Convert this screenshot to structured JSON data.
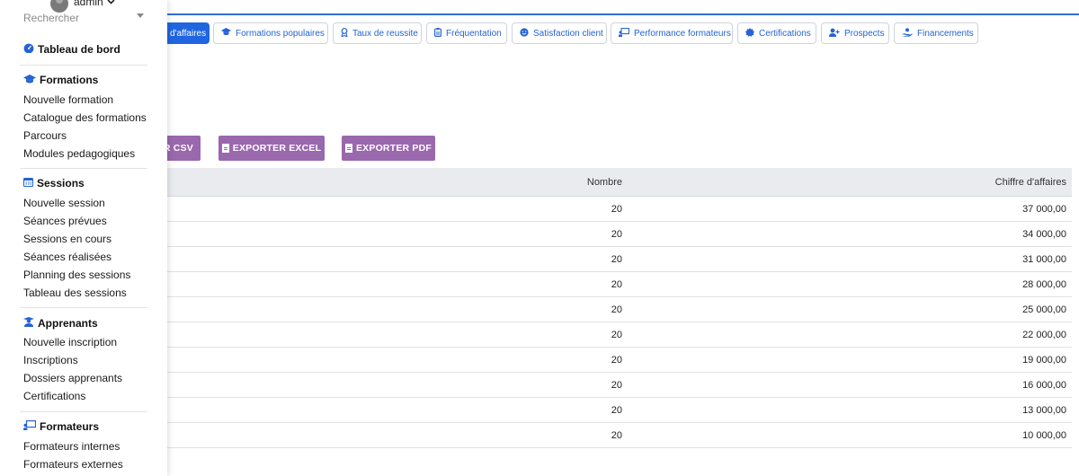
{
  "sidebar": {
    "user": {
      "name": "admin"
    },
    "search": {
      "placeholder": "Rechercher"
    },
    "dashboard": {
      "label": "Tableau de bord"
    },
    "sections": {
      "formations": {
        "title": "Formations",
        "items": [
          "Nouvelle formation",
          "Catalogue des formations",
          "Parcours",
          "Modules pedagogiques"
        ]
      },
      "sessions": {
        "title": "Sessions",
        "items": [
          "Nouvelle session",
          "Séances prévues",
          "Sessions en cours",
          "Séances réalisées",
          "Planning des sessions",
          "Tableau des sessions"
        ]
      },
      "apprenants": {
        "title": "Apprenants",
        "items": [
          "Nouvelle inscription",
          "Inscriptions",
          "Dossiers apprenants",
          "Certifications"
        ]
      },
      "formateurs": {
        "title": "Formateurs",
        "items": [
          "Formateurs internes",
          "Formateurs externes"
        ]
      }
    }
  },
  "tabs": [
    {
      "label": "d'affaires",
      "icon": "",
      "active": true
    },
    {
      "label": "Formations populaires",
      "icon": "graduation-cap-icon"
    },
    {
      "label": "Taux de reussite",
      "icon": "award-icon"
    },
    {
      "label": "Fréquentation",
      "icon": "clipboard-icon"
    },
    {
      "label": "Satisfaction client",
      "icon": "smile-icon"
    },
    {
      "label": "Performance formateurs",
      "icon": "chalkboard-teacher-icon"
    },
    {
      "label": "Certifications",
      "icon": "certificate-icon"
    },
    {
      "label": "Prospects",
      "icon": "user-plus-icon"
    },
    {
      "label": "Financements",
      "icon": "hand-holding-money-icon"
    }
  ],
  "exports": {
    "csv": "R CSV",
    "excel": "EXPORTER EXCEL",
    "pdf": "EXPORTER PDF"
  },
  "table": {
    "headers": {
      "nombre": "Nombre",
      "chiffre": "Chiffre d'affaires"
    },
    "rows": [
      {
        "nombre": "20",
        "chiffre": "37 000,00"
      },
      {
        "nombre": "20",
        "chiffre": "34 000,00"
      },
      {
        "nombre": "20",
        "chiffre": "31 000,00"
      },
      {
        "nombre": "20",
        "chiffre": "28 000,00"
      },
      {
        "nombre": "20",
        "chiffre": "25 000,00"
      },
      {
        "nombre": "20",
        "chiffre": "22 000,00"
      },
      {
        "nombre": "20",
        "chiffre": "19 000,00"
      },
      {
        "nombre": "20",
        "chiffre": "16 000,00"
      },
      {
        "nombre": "20",
        "chiffre": "13 000,00"
      },
      {
        "nombre": "20",
        "chiffre": "10 000,00"
      }
    ]
  },
  "colors": {
    "accent": "#1f66e0",
    "export_button": "#9a68ad",
    "table_header_bg": "#e9ebef"
  }
}
